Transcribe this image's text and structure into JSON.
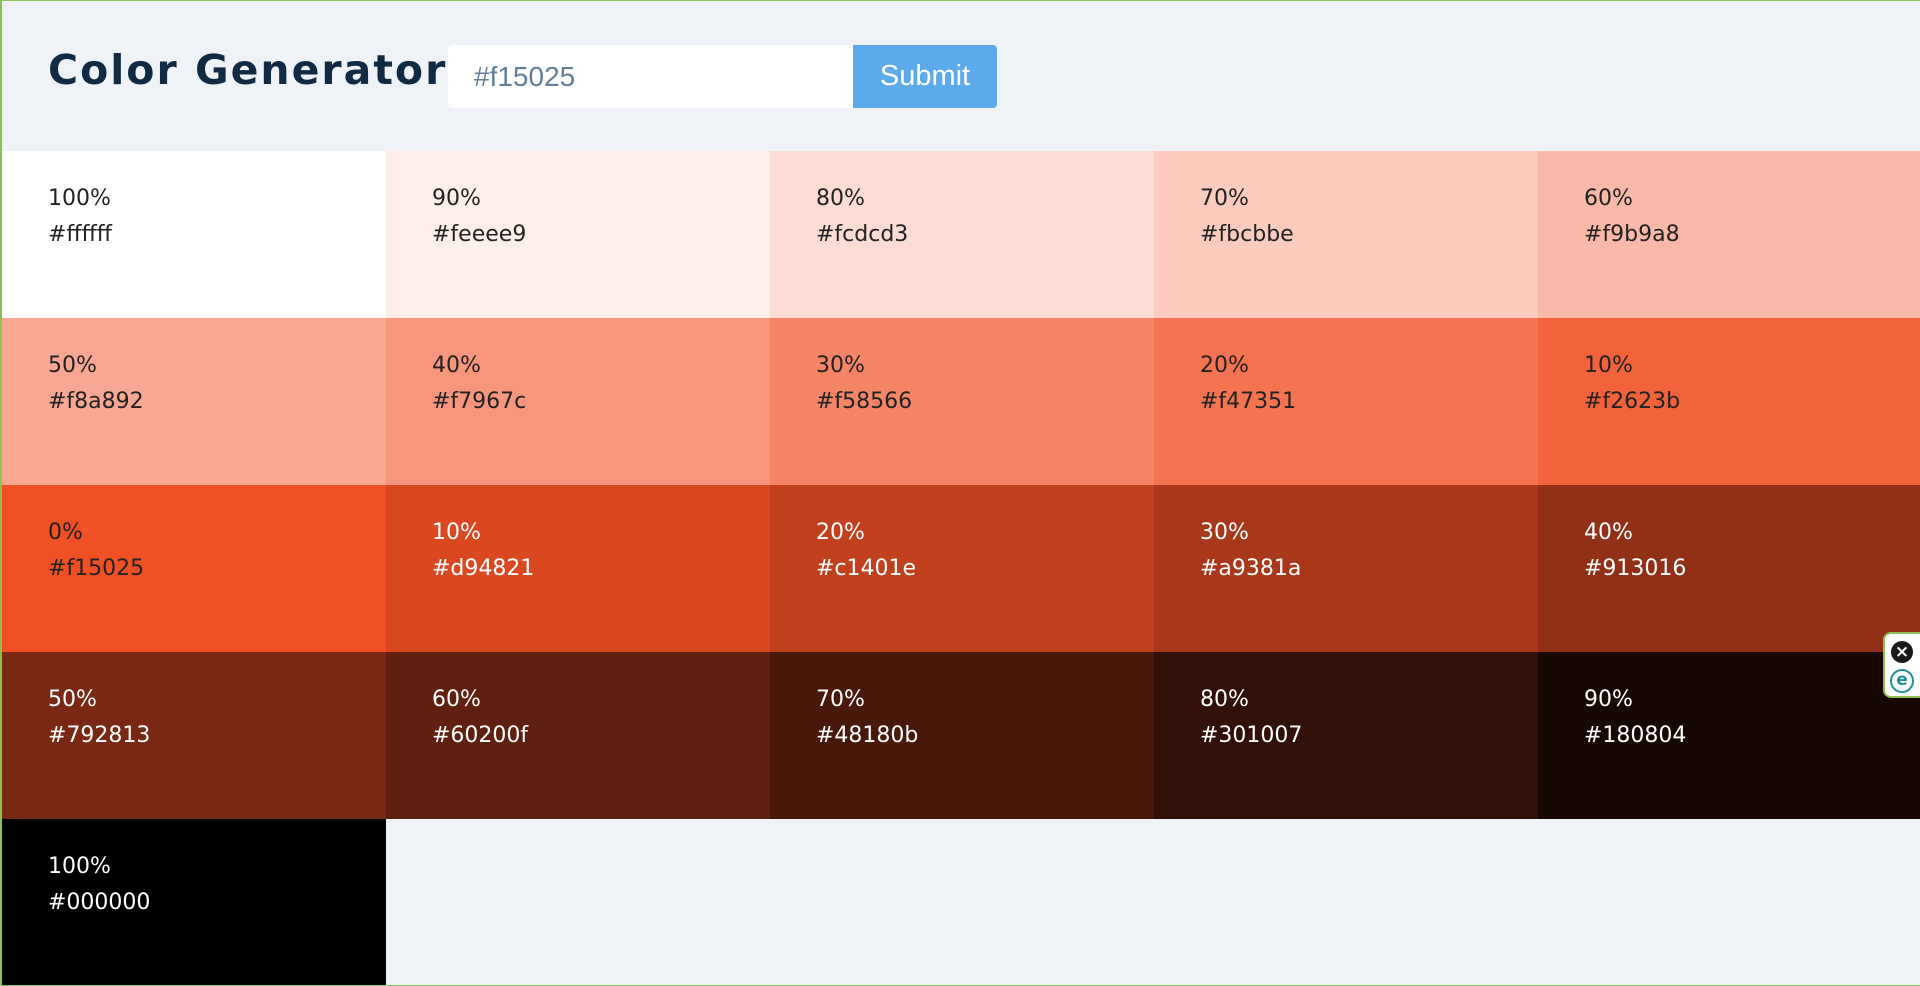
{
  "header": {
    "title": "Color Generator",
    "input_value": "",
    "input_placeholder": "#f15025",
    "submit_label": "Submit"
  },
  "swatches": [
    {
      "percent": "100%",
      "hex": "#ffffff",
      "text_color": "#222222"
    },
    {
      "percent": "90%",
      "hex": "#feeee9",
      "text_color": "#222222"
    },
    {
      "percent": "80%",
      "hex": "#fcdcd3",
      "text_color": "#222222"
    },
    {
      "percent": "70%",
      "hex": "#fbcbbe",
      "text_color": "#222222"
    },
    {
      "percent": "60%",
      "hex": "#f9b9a8",
      "text_color": "#222222"
    },
    {
      "percent": "50%",
      "hex": "#f8a892",
      "text_color": "#222222"
    },
    {
      "percent": "40%",
      "hex": "#f7967c",
      "text_color": "#222222"
    },
    {
      "percent": "30%",
      "hex": "#f58566",
      "text_color": "#222222"
    },
    {
      "percent": "20%",
      "hex": "#f47351",
      "text_color": "#222222"
    },
    {
      "percent": "10%",
      "hex": "#f2623b",
      "text_color": "#222222"
    },
    {
      "percent": "0%",
      "hex": "#f15025",
      "text_color": "#222222"
    },
    {
      "percent": "10%",
      "hex": "#d94821",
      "text_color": "#ffffff"
    },
    {
      "percent": "20%",
      "hex": "#c1401e",
      "text_color": "#ffffff"
    },
    {
      "percent": "30%",
      "hex": "#a9381a",
      "text_color": "#ffffff"
    },
    {
      "percent": "40%",
      "hex": "#913016",
      "text_color": "#ffffff"
    },
    {
      "percent": "50%",
      "hex": "#792813",
      "text_color": "#ffffff"
    },
    {
      "percent": "60%",
      "hex": "#60200f",
      "text_color": "#ffffff"
    },
    {
      "percent": "70%",
      "hex": "#48180b",
      "text_color": "#ffffff"
    },
    {
      "percent": "80%",
      "hex": "#301007",
      "text_color": "#ffffff"
    },
    {
      "percent": "90%",
      "hex": "#180804",
      "text_color": "#ffffff"
    },
    {
      "percent": "100%",
      "hex": "#000000",
      "text_color": "#ffffff"
    }
  ],
  "colors": {
    "page_background": "#eff3f7",
    "title": "#102a43",
    "button": "#5ca9ec",
    "frame": "#8cc152"
  },
  "extension_widget": {
    "icons": [
      "close-circle-icon",
      "e-logo-icon"
    ]
  }
}
